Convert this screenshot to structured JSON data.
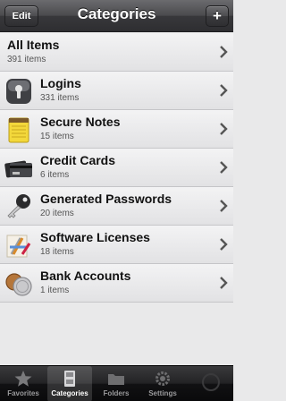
{
  "navbar": {
    "title": "Categories",
    "edit_label": "Edit",
    "add_label": "+"
  },
  "list": {
    "all_items": {
      "title": "All Items",
      "count": "391 items"
    },
    "categories": [
      {
        "icon": "key-lock-icon",
        "title": "Logins",
        "count": "331 items"
      },
      {
        "icon": "notes-icon",
        "title": "Secure Notes",
        "count": "15 items"
      },
      {
        "icon": "credit-card-icon",
        "title": "Credit Cards",
        "count": "6 items"
      },
      {
        "icon": "key-icon",
        "title": "Generated Passwords",
        "count": "20 items"
      },
      {
        "icon": "app-store-icon",
        "title": "Software Licenses",
        "count": "18 items"
      },
      {
        "icon": "coins-icon",
        "title": "Bank Accounts",
        "count": "1 items"
      }
    ]
  },
  "tabbar": {
    "tabs": [
      {
        "icon": "star-icon",
        "label": "Favorites"
      },
      {
        "icon": "cabinet-icon",
        "label": "Categories"
      },
      {
        "icon": "folder-icon",
        "label": "Folders"
      },
      {
        "icon": "gear-icon",
        "label": "Settings"
      }
    ]
  }
}
